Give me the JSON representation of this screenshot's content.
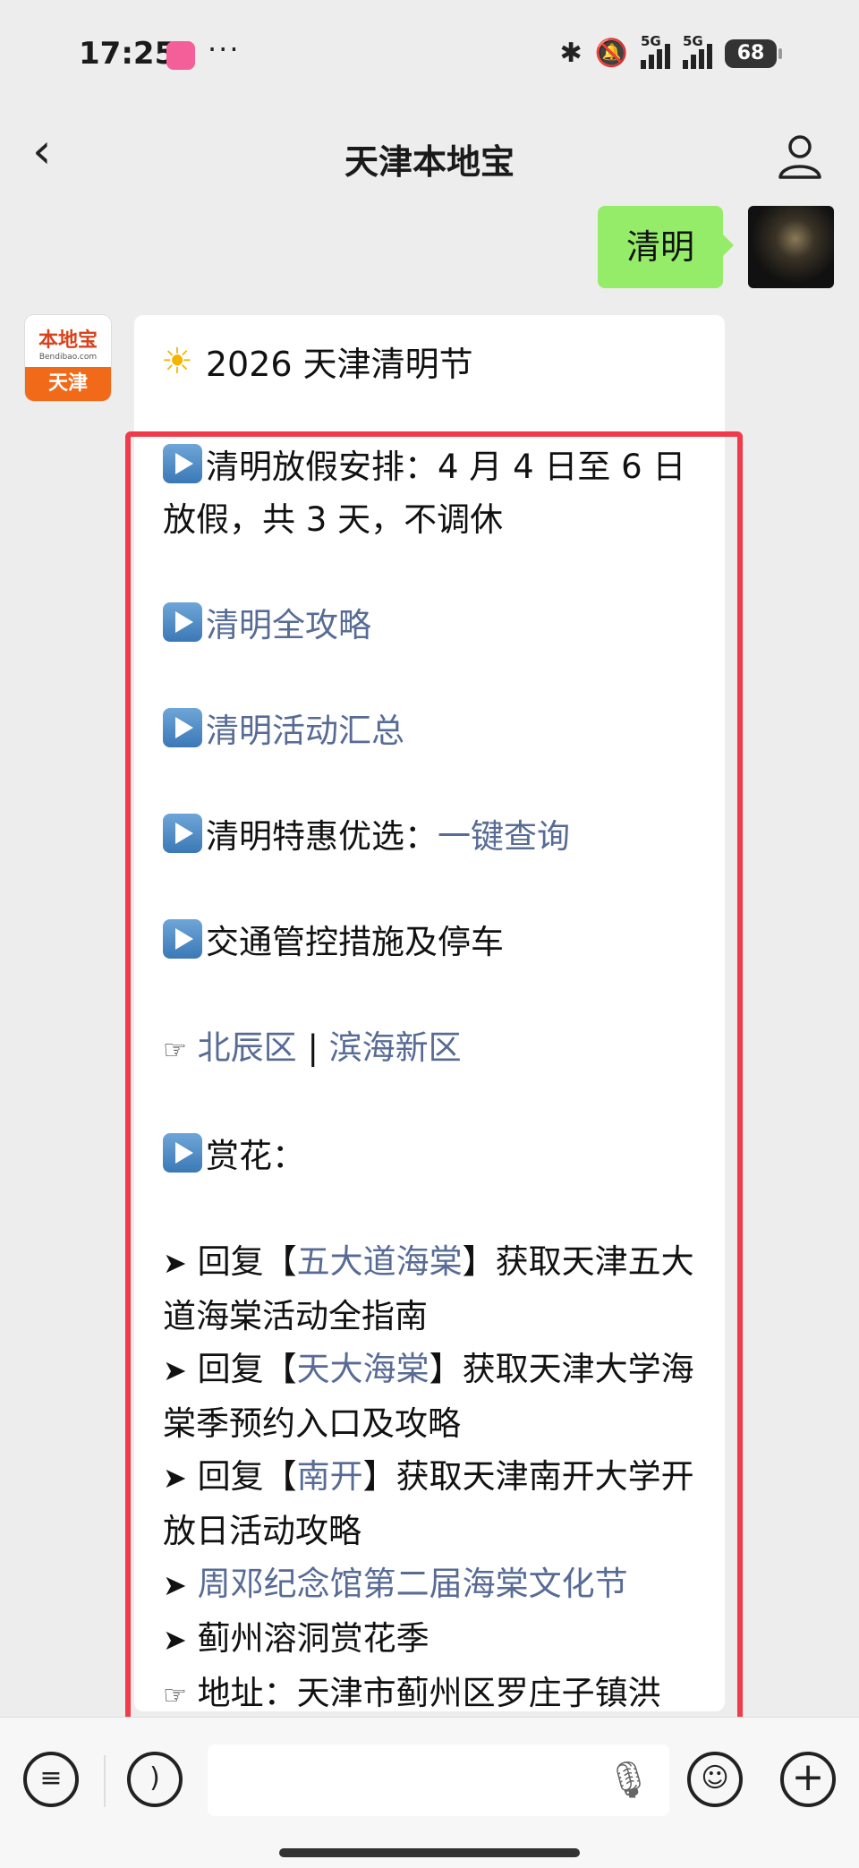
{
  "status": {
    "time": "17:25",
    "dots": "···",
    "signal1": "5G",
    "signal2": "5G",
    "battery": "68"
  },
  "header": {
    "back_icon": "chevron-left-icon",
    "title": "天津本地宝",
    "profile_icon": "person-icon"
  },
  "outgoing": {
    "text": "清明"
  },
  "bot": {
    "avatar_top": "本地宝",
    "avatar_small": "Bendibao.com",
    "avatar_bottom": "天津"
  },
  "message": {
    "heading": "2026 天津清明节",
    "holiday": "清明放假安排：4 月 4 日至 6 日放假，共 3 天，不调休",
    "guide": "清明全攻略",
    "activities": "清明活动汇总",
    "deals_prefix": "清明特惠优选：",
    "deals_link": "一键查询",
    "traffic": "交通管控措施及停车",
    "district1": "北辰区",
    "pipe": "|",
    "district2": "滨海新区",
    "flowers": "赏花：",
    "reply1_prefix": "回复【",
    "reply1_link": "五大道海棠",
    "reply1_suffix": "】获取天津五大道海棠活动全指南",
    "reply2_prefix": "回复【",
    "reply2_link": "天大海棠",
    "reply2_suffix": "】获取天津大学海棠季预约入口及攻略",
    "reply3_prefix": "回复【",
    "reply3_link": "南开",
    "reply3_suffix": "】获取天津南开大学开放日活动攻略",
    "festival": "周邓纪念馆第二届海棠文化节",
    "cave": "蓟州溶洞赏花季",
    "address": "地址：天津市蓟州区罗庄子镇洪"
  },
  "colors": {
    "link": "#576b95",
    "outgoing_bubble": "#95ec69",
    "highlight_box": "#ef3b4a"
  }
}
